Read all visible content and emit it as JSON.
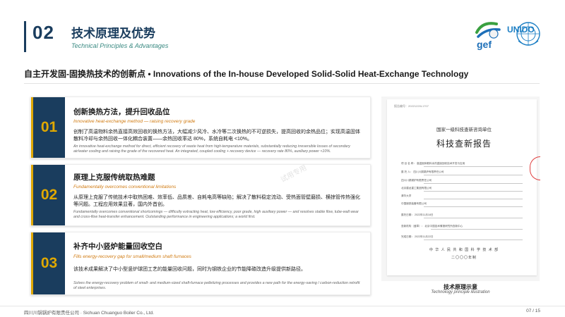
{
  "header": {
    "number": "02",
    "title": "技术原理及优势",
    "subtitle": "Technical Principles & Advantages"
  },
  "logos": {
    "gef_text": "gef",
    "unido_text": "UNIDO"
  },
  "section_heading": "自主开发固-固换热技术的创新点 • Innovations of the In-house Developed Solid-Solid Heat-Exchange Technology",
  "cards": [
    {
      "number": "01",
      "title": "创新换热方法，提升回收品位",
      "subtitle": "Innovative heat-exchange method — raising recovery grade",
      "body_cn": "创制了高温物料余热直接高效回收的换热方法，大幅减少风冷、水冷等二次换热的不可逆损失，提高回收的余热品位；实现高温固体散料冷却与余热回收一体化耦合装置——余热回收率达 80%，系统自耗电 <10%。",
      "body_en": "An innovative heat-exchange method for direct, efficient recovery of waste heat from high-temperature materials, substantially reducing irreversible losses of secondary air/water cooling and raising the grade of the recovered heat. An integrated, coupled cooling + recovery device — recovery rate 80%, auxiliary power <10%."
    },
    {
      "number": "02",
      "title": "原理上克服传统取热难题",
      "subtitle": "Fundamentally overcomes conventional limitations",
      "body_cn": "从原理上克服了传统技术中取热困难、效率低、品质差、自耗电高等缺陷；解决了散料稳定流动、受热面管壁磨损、横掠管传热强化等问题。工程应用效果显著，国内外首创。",
      "body_en": "Fundamentally overcomes conventional shortcomings — difficulty extracting heat, low efficiency, poor grade, high auxiliary power — and resolves stable flow, tube-wall wear and cross-flow heat-transfer enhancement. Outstanding performance in engineering applications; a world first."
    },
    {
      "number": "03",
      "title": "补齐中小竖炉能量回收空白",
      "subtitle": "Fills energy-recovery gap for small/medium shaft furnaces",
      "body_cn": "该技术成果解决了中小型竖炉球团工艺的能量回收问题，同时为钢铁企业的节能降碳改造升级提供新路径。",
      "body_en": "Solves the energy-recovery problem of small- and medium-sized shaft-furnace pelletizing processes and provides a new path for the energy-saving / carbon-reduction retrofit of steel enterprises."
    }
  ],
  "document": {
    "report_no": "报告编号：20221220L1707",
    "org": "国家一级科技查新咨询单位",
    "title": "科技查新报告",
    "fields": [
      "项 目 名 称：  高温固体散料余热直接回收技术开发与应用",
      "委 托 人：   四川川锅锅炉有限责任公司",
      "              四川川锅锅炉有限责任公司",
      "              北京建龙重工集团有限公司",
      "              清华大学",
      "              中国钢铁装备有限公司",
      "委托日期：   2022年11月18日",
      "查新机构（盖章）：  北京中国技术情报研究所查新中心",
      "完成日期：   2022年11月22日"
    ],
    "issuer": "中 华 人 民 共 和 国 科 学 技 术 部",
    "year": "二〇〇〇年制",
    "caption_cn": "技术原理示意",
    "caption_en": "Technology principle illustration"
  },
  "watermark": "试用专用",
  "footer": {
    "left": "四川川锅锅炉有限责任公司 · Sichuan Chuanguo Boiler Co., Ltd.",
    "page": "07 / 15"
  },
  "colors": {
    "navy": "#1a3d5e",
    "gold": "#e0a800",
    "teal": "#3a8a82",
    "orange": "#d07a10"
  }
}
